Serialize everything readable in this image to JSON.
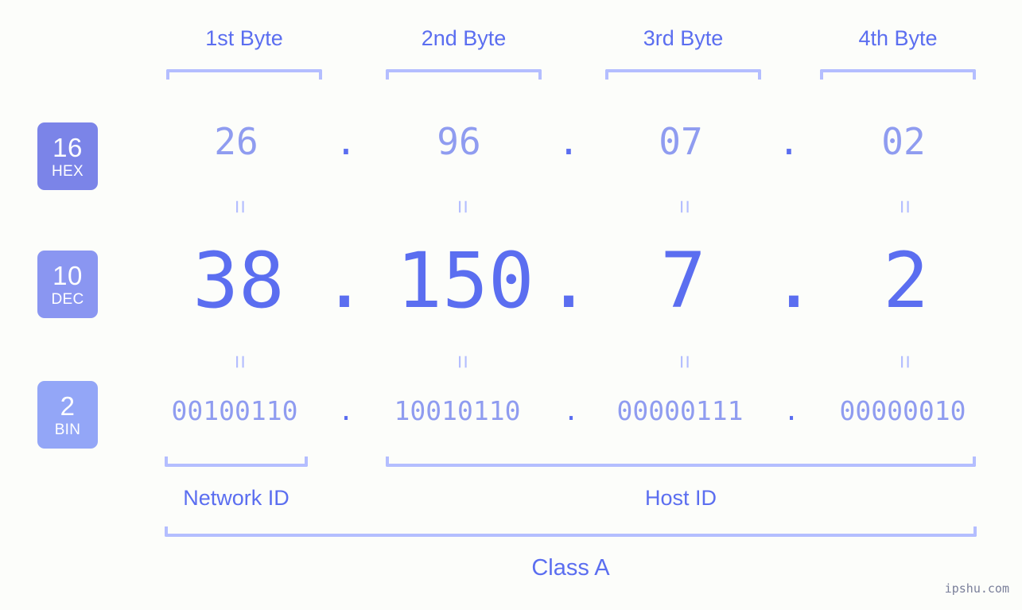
{
  "background_color": "#fcfdfa",
  "accent_color": "#5b6ef0",
  "accent_light_color": "#8f9cf0",
  "bracket_color": "#b4beff",
  "header": {
    "byte_labels": [
      "1st Byte",
      "2nd Byte",
      "3rd Byte",
      "4th Byte"
    ]
  },
  "rows": [
    {
      "key": "hex",
      "base": "16",
      "abbr": "HEX",
      "badge_color": "#7b84e8",
      "values": [
        "26",
        "96",
        "07",
        "02"
      ],
      "separator": "."
    },
    {
      "key": "dec",
      "base": "10",
      "abbr": "DEC",
      "badge_color": "#8a96f1",
      "values": [
        "38",
        "150",
        "7",
        "2"
      ],
      "separator": "."
    },
    {
      "key": "bin",
      "base": "2",
      "abbr": "BIN",
      "badge_color": "#93a6f7",
      "values": [
        "00100110",
        "10010110",
        "00000111",
        "00000010"
      ],
      "separator": "."
    }
  ],
  "equals_symbol": "=",
  "footer": {
    "network_id_label": "Network ID",
    "host_id_label": "Host ID",
    "class_label": "Class A"
  },
  "watermark": "ipshu.com"
}
